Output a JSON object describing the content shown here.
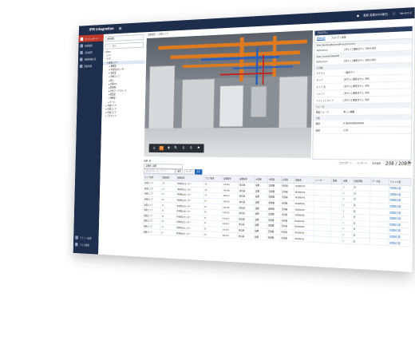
{
  "app": {
    "title": "IFM integration",
    "version": "Ver.6.0.2",
    "user": "藤原 真理(DRG様式)",
    "logout": "ログアウト",
    "settings": "表示設定"
  },
  "sidebar": {
    "items": [
      {
        "label": "ダッシュボード",
        "active": true
      },
      {
        "label": "設備管理",
        "active": false
      },
      {
        "label": "点検管理",
        "active": false
      },
      {
        "label": "長期修繕計画",
        "active": false
      },
      {
        "label": "図面情報",
        "active": false
      }
    ],
    "bottom": [
      {
        "label": "テナント管理"
      },
      {
        "label": "マスタ管理"
      }
    ]
  },
  "tree": {
    "select": "全体構造",
    "search": "ツリー検索",
    "nodes": [
      {
        "label": "▾ Root",
        "indent": 0
      },
      {
        "label": "▸ 1F",
        "indent": 1
      },
      {
        "label": "▸ 2F",
        "indent": 1
      },
      {
        "label": "▾ 倉庫エリア",
        "indent": 1,
        "selected": true
      },
      {
        "label": "▸ 機械室",
        "indent": 2
      },
      {
        "label": "▸ 中央防災センター",
        "indent": 2
      },
      {
        "label": "▸ 電気室",
        "indent": 2
      },
      {
        "label": "▸ 事務エリア",
        "indent": 2
      },
      {
        "label": "▸ 屋上",
        "indent": 2
      },
      {
        "label": "▸ 倉庫E/V",
        "indent": 2
      },
      {
        "label": "▸ 駐車場",
        "indent": 2
      },
      {
        "label": "▸ 中央ワークスペース",
        "indent": 2
      },
      {
        "label": "▸ 会議室",
        "indent": 2
      },
      {
        "label": "▸ 休憩室",
        "indent": 2
      },
      {
        "label": "▸ ホール",
        "indent": 2
      },
      {
        "label": "▸ 外部エリア",
        "indent": 1
      },
      {
        "label": "▸ 共用エリア",
        "indent": 1
      },
      {
        "label": "▸ 外構エリア",
        "indent": 1
      },
      {
        "label": "▸ ラボエリア",
        "indent": 1
      }
    ]
  },
  "main": {
    "breadcrumb": "建物選択 ＞ 倉庫エリア",
    "viewer_tools": [
      "⌂",
      "↻",
      "✥",
      "🔍",
      "⚲",
      "♁",
      "⚑"
    ]
  },
  "props": {
    "title": "プロパティ",
    "tabs": [
      "要素情報",
      "プロパティ情報"
    ],
    "rows": [
      {
        "k": "Pset_BuildingElementProxyCommon",
        "v": "",
        "sec": true
      },
      {
        "k": "Reference",
        "v": "[ダクト] 角形ダクト 300×300"
      },
      {
        "k": "Pset_QuantityTakeOff",
        "v": "",
        "sec": true
      },
      {
        "k": "Reference",
        "v": "[ダクト] 角形ダクト 300×300"
      },
      {
        "k": "その他",
        "v": "",
        "sec": true
      },
      {
        "k": "カテゴリ",
        "v": "一般ダクト"
      },
      {
        "k": "タイプ",
        "v": "[ダクト] 角形ダクト 300"
      },
      {
        "k": "タイプ 名",
        "v": "[ダクト] 角形ダクト 300"
      },
      {
        "k": "ファミリ",
        "v": "[ダクト] 角形ダクト 300"
      },
      {
        "k": "ファミリとタイプ",
        "v": "[ダクト] 角形ダクト 300"
      },
      {
        "k": "フェーズ",
        "v": "",
        "sec": true
      },
      {
        "k": "構築フェーズ",
        "v": "新しい構築"
      },
      {
        "k": "寸法",
        "v": "",
        "sec": true
      },
      {
        "k": "面積",
        "v": "0.3000000000000"
      },
      {
        "k": "容積",
        "v": "1.02"
      }
    ]
  },
  "list": {
    "title": "設備一覧",
    "filter": "全要素 / 設備",
    "search_placeholder": "検索文字を入力して下さい",
    "buttons": [
      "検索",
      "クリア",
      "表示"
    ],
    "actions": [
      "エクスポート",
      "インポート",
      "表示設定"
    ],
    "count": "208 / 208件",
    "columns": [
      "エリア名称",
      "階層名称",
      "部屋名称",
      "フロア名称",
      "設備番号",
      "設備名称",
      "大項目",
      "中項目",
      "小項目",
      "製品名",
      "メーカー",
      "型番",
      "台数",
      "点検周期",
      "データ名",
      "ファイル名"
    ],
    "rows": [
      [
        "倉庫エリア",
        "1F",
        "中央防災センター",
        "1F",
        "D0145",
        "換気扇",
        "設備",
        "空調機",
        "天井扇",
        "MGB8045",
        "",
        "",
        "1",
        "日",
        "",
        "空調換気図"
      ],
      [
        "倉庫エリア",
        "1F",
        "中央防災センター",
        "1F",
        "D0146",
        "換気扇",
        "設備",
        "空調機",
        "天井扇",
        "MGB8045",
        "",
        "",
        "1",
        "日",
        "",
        "空調換気図"
      ],
      [
        "倉庫エリア",
        "1F",
        "中央防災センター",
        "1F",
        "D0147",
        "換気扇",
        "設備",
        "空調機",
        "天井扇",
        "MGB8045",
        "",
        "",
        "1",
        "日",
        "",
        "空調換気図"
      ],
      [
        "倉庫エリア",
        "1F",
        "中央防災センター",
        "1F",
        "D0148",
        "換気扇",
        "設備",
        "送風機",
        "天井扇",
        "MGB8045",
        "",
        "",
        "1",
        "月",
        "",
        "空調換気図"
      ],
      [
        "倉庫エリア",
        "1F",
        "中央防災センター",
        "1F",
        "D0149",
        "換気扇",
        "設備",
        "送風機",
        "天井扇",
        "MGB8045",
        "",
        "",
        "1",
        "月",
        "",
        "空調換気図"
      ],
      [
        "倉庫エリア",
        "1F",
        "中央防災センター",
        "1F",
        "D0150",
        "換気扇",
        "設備",
        "空調機",
        "天井扇",
        "MGB8045",
        "",
        "",
        "1",
        "日",
        "",
        "空調換気図"
      ],
      [
        "倉庫エリア",
        "1F",
        "中央防災センター",
        "1F",
        "D0151",
        "換気扇",
        "設備",
        "空調機",
        "天井扇",
        "MGB8045",
        "",
        "",
        "1",
        "日",
        "",
        "空調換気図"
      ],
      [
        "倉庫エリア",
        "1F",
        "中央防災センター",
        "1F",
        "D0152",
        "換気扇",
        "設備",
        "空調機",
        "天井扇",
        "MGB8045",
        "",
        "",
        "1",
        "日",
        "",
        "空調換気図"
      ],
      [
        "倉庫エリア",
        "1F",
        "中央防災センター",
        "1F",
        "D0153",
        "換気扇",
        "設備",
        "空調機",
        "天井扇",
        "MGB8045",
        "",
        "",
        "1",
        "日",
        "",
        "空調換気図"
      ],
      [
        "倉庫エリア",
        "1F",
        "中央防災センター",
        "1F",
        "D0154",
        "換気扇",
        "設備",
        "空調機",
        "天井扇",
        "MGB8045",
        "",
        "",
        "1",
        "日",
        "",
        "空調換気図"
      ]
    ]
  }
}
